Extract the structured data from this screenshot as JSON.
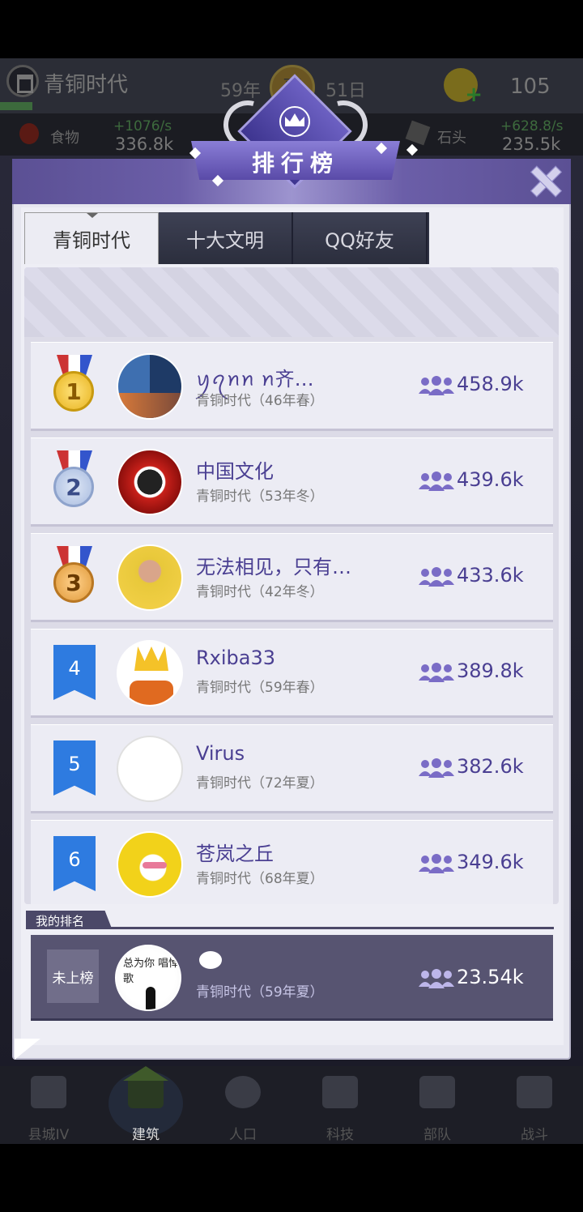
{
  "status": {
    "age_name": "青铜时代",
    "year": "59年",
    "season": "夏",
    "day": "51日",
    "gems": "105"
  },
  "resources": {
    "food": {
      "label": "食物",
      "rate": "+1076/s",
      "amount": "336.8k"
    },
    "stone": {
      "label": "石头",
      "rate": "+628.8/s",
      "amount": "235.5k"
    }
  },
  "dialog": {
    "title": "排行榜",
    "tabs": [
      {
        "label": "青铜时代",
        "active": true
      },
      {
        "label": "十大文明",
        "active": false
      },
      {
        "label": "QQ好友",
        "active": false
      }
    ]
  },
  "rankings": [
    {
      "rank": "1",
      "name": "ꪗꪖꪀꪀ ꪀ齐…",
      "sub": "青铜时代（46年春）",
      "population": "458.9k"
    },
    {
      "rank": "2",
      "name": "中国文化",
      "sub": "青铜时代（53年冬）",
      "population": "439.6k"
    },
    {
      "rank": "3",
      "name": "无法相见，只有…",
      "sub": "青铜时代（42年冬）",
      "population": "433.6k"
    },
    {
      "rank": "4",
      "name": "Rxiba33",
      "sub": "青铜时代（59年春）",
      "population": "389.8k"
    },
    {
      "rank": "5",
      "name": "Virus",
      "sub": "青铜时代（72年夏）",
      "population": "382.6k"
    },
    {
      "rank": "6",
      "name": "苍岚之丘",
      "sub": "青铜时代（68年夏）",
      "population": "349.6k"
    }
  ],
  "my_rank": {
    "section_label": "我的排名",
    "badge": "未上榜",
    "avatar_text": "总为你 唱悼歌",
    "sub": "青铜时代（59年夏）",
    "population": "23.54k"
  },
  "nav": [
    {
      "label": "县城IV",
      "icon": "castle-icon"
    },
    {
      "label": "建筑",
      "icon": "house-icon"
    },
    {
      "label": "人口",
      "icon": "person-icon"
    },
    {
      "label": "科技",
      "icon": "book-icon"
    },
    {
      "label": "部队",
      "icon": "banner-icon"
    },
    {
      "label": "战斗",
      "icon": "swords-icon"
    }
  ]
}
